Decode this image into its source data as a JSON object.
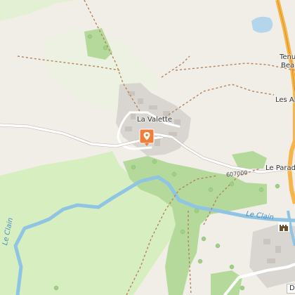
{
  "map": {
    "places": {
      "village": "La Valette",
      "tenu": "Tenu",
      "beau": "Beau",
      "les_a": "Les Al",
      "le_parad": "Le Parad",
      "corner_box": "D"
    },
    "water": {
      "river_left": "Le Clain",
      "river_right": "Le Clain"
    },
    "roads": {
      "ref": "607000"
    },
    "marker": {
      "icon": "location-pin-icon",
      "color": "#f07d38"
    },
    "colors": {
      "background": "#f1eee8",
      "forest": "#d6eec0",
      "forest_dark": "#b4d99a",
      "water": "#b3d6ec",
      "river": "#8fc4e3",
      "built": "#d9d6d1",
      "main_road": "#f6b44a"
    }
  }
}
